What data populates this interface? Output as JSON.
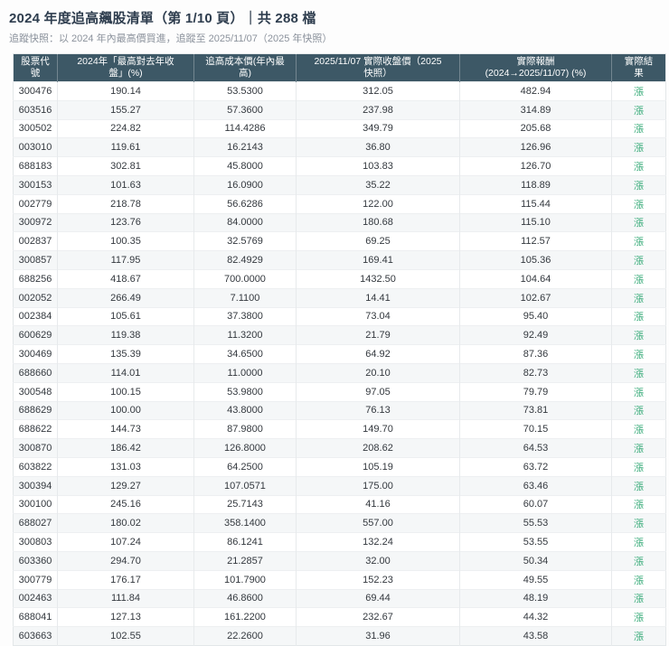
{
  "page": {
    "title": "2024 年度追高飆股清單（第 1/10 頁）｜共 288 檔",
    "subtitle": "追蹤快照：以 2024 年內最高價買進，追蹤至 2025/11/07（2025 年快照）"
  },
  "chart_data": {
    "type": "table",
    "title": "2024 年度追高飆股清單（第 1/10 頁）｜共 288 檔",
    "page_number": "1/10",
    "total_count": "288",
    "columns": [
      "股票代\n號",
      "2024年「最高對去年收\n盤」(%)",
      "追高成本價(年內最\n高)",
      "2025/11/07 實際收盤價（2025\n快照）",
      "實際報酬\n(2024→2025/11/07) (%)",
      "實際結\n果"
    ],
    "rows": [
      [
        "300476",
        "190.14",
        "53.5300",
        "312.05",
        "482.94",
        "漲"
      ],
      [
        "603516",
        "155.27",
        "57.3600",
        "237.98",
        "314.89",
        "漲"
      ],
      [
        "300502",
        "224.82",
        "114.4286",
        "349.79",
        "205.68",
        "漲"
      ],
      [
        "003010",
        "119.61",
        "16.2143",
        "36.80",
        "126.96",
        "漲"
      ],
      [
        "688183",
        "302.81",
        "45.8000",
        "103.83",
        "126.70",
        "漲"
      ],
      [
        "300153",
        "101.63",
        "16.0900",
        "35.22",
        "118.89",
        "漲"
      ],
      [
        "002779",
        "218.78",
        "56.6286",
        "122.00",
        "115.44",
        "漲"
      ],
      [
        "300972",
        "123.76",
        "84.0000",
        "180.68",
        "115.10",
        "漲"
      ],
      [
        "002837",
        "100.35",
        "32.5769",
        "69.25",
        "112.57",
        "漲"
      ],
      [
        "300857",
        "117.95",
        "82.4929",
        "169.41",
        "105.36",
        "漲"
      ],
      [
        "688256",
        "418.67",
        "700.0000",
        "1432.50",
        "104.64",
        "漲"
      ],
      [
        "002052",
        "266.49",
        "7.1100",
        "14.41",
        "102.67",
        "漲"
      ],
      [
        "002384",
        "105.61",
        "37.3800",
        "73.04",
        "95.40",
        "漲"
      ],
      [
        "600629",
        "119.38",
        "11.3200",
        "21.79",
        "92.49",
        "漲"
      ],
      [
        "300469",
        "135.39",
        "34.6500",
        "64.92",
        "87.36",
        "漲"
      ],
      [
        "688660",
        "114.01",
        "11.0000",
        "20.10",
        "82.73",
        "漲"
      ],
      [
        "300548",
        "100.15",
        "53.9800",
        "97.05",
        "79.79",
        "漲"
      ],
      [
        "688629",
        "100.00",
        "43.8000",
        "76.13",
        "73.81",
        "漲"
      ],
      [
        "688622",
        "144.73",
        "87.9800",
        "149.70",
        "70.15",
        "漲"
      ],
      [
        "300870",
        "186.42",
        "126.8000",
        "208.62",
        "64.53",
        "漲"
      ],
      [
        "603822",
        "131.03",
        "64.2500",
        "105.19",
        "63.72",
        "漲"
      ],
      [
        "300394",
        "129.27",
        "107.0571",
        "175.00",
        "63.46",
        "漲"
      ],
      [
        "300100",
        "245.16",
        "25.7143",
        "41.16",
        "60.07",
        "漲"
      ],
      [
        "688027",
        "180.02",
        "358.1400",
        "557.00",
        "55.53",
        "漲"
      ],
      [
        "300803",
        "107.24",
        "86.1241",
        "132.24",
        "53.55",
        "漲"
      ],
      [
        "603360",
        "294.70",
        "21.2857",
        "32.00",
        "50.34",
        "漲"
      ],
      [
        "300779",
        "176.17",
        "101.7900",
        "152.23",
        "49.55",
        "漲"
      ],
      [
        "002463",
        "111.84",
        "46.8600",
        "69.44",
        "48.19",
        "漲"
      ],
      [
        "688041",
        "127.13",
        "161.2200",
        "232.67",
        "44.32",
        "漲"
      ],
      [
        "603663",
        "102.55",
        "22.2600",
        "31.96",
        "43.58",
        "漲"
      ]
    ],
    "layout": "30 rows per page, all cells center-aligned, zebra striping"
  },
  "colors": {
    "header_bg": "#3d5866",
    "header_text": "#ffffff",
    "title_text": "#2e3d4e",
    "subtitle_text": "#8b929c",
    "cell_text": "#33383e",
    "result_up_green": "#3fae7e",
    "row_stripe": "#f5f7f8"
  }
}
